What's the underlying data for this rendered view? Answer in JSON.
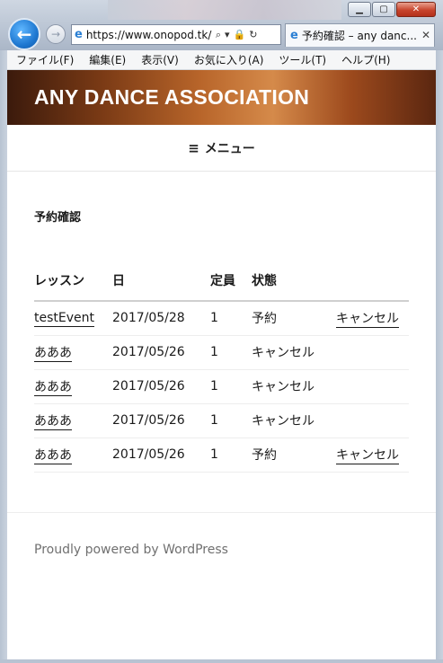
{
  "browser": {
    "address": "https://www.onopod.tk/",
    "tab_title": "予約確認 – any danc...",
    "menu": [
      "ファイル(F)",
      "編集(E)",
      "表示(V)",
      "お気に入り(A)",
      "ツール(T)",
      "ヘルプ(H)"
    ]
  },
  "site": {
    "title": "ANY DANCE ASSOCIATION",
    "menu_label": "メニュー"
  },
  "page": {
    "heading": "予約確認",
    "table": {
      "headers": [
        "レッスン",
        "日",
        "定員",
        "状態",
        ""
      ],
      "rows": [
        {
          "lesson": "testEvent",
          "date": "2017/05/28",
          "capacity": "1",
          "status": "予約",
          "action": "キャンセル"
        },
        {
          "lesson": "あああ",
          "date": "2017/05/26",
          "capacity": "1",
          "status": "キャンセル",
          "action": ""
        },
        {
          "lesson": "あああ",
          "date": "2017/05/26",
          "capacity": "1",
          "status": "キャンセル",
          "action": ""
        },
        {
          "lesson": "あああ",
          "date": "2017/05/26",
          "capacity": "1",
          "status": "キャンセル",
          "action": ""
        },
        {
          "lesson": "あああ",
          "date": "2017/05/26",
          "capacity": "1",
          "status": "予約",
          "action": "キャンセル"
        }
      ]
    }
  },
  "footer": {
    "text": "Proudly powered by WordPress"
  },
  "icons": {
    "back": "back-arrow-icon",
    "forward": "forward-arrow-icon",
    "menu": "hamburger-icon",
    "ie": "ie-icon"
  },
  "colors": {
    "header_dark": "#3b1a0c",
    "header_light": "#d58a4a",
    "back_button": "#1f78d1",
    "footer_text": "#707070"
  }
}
